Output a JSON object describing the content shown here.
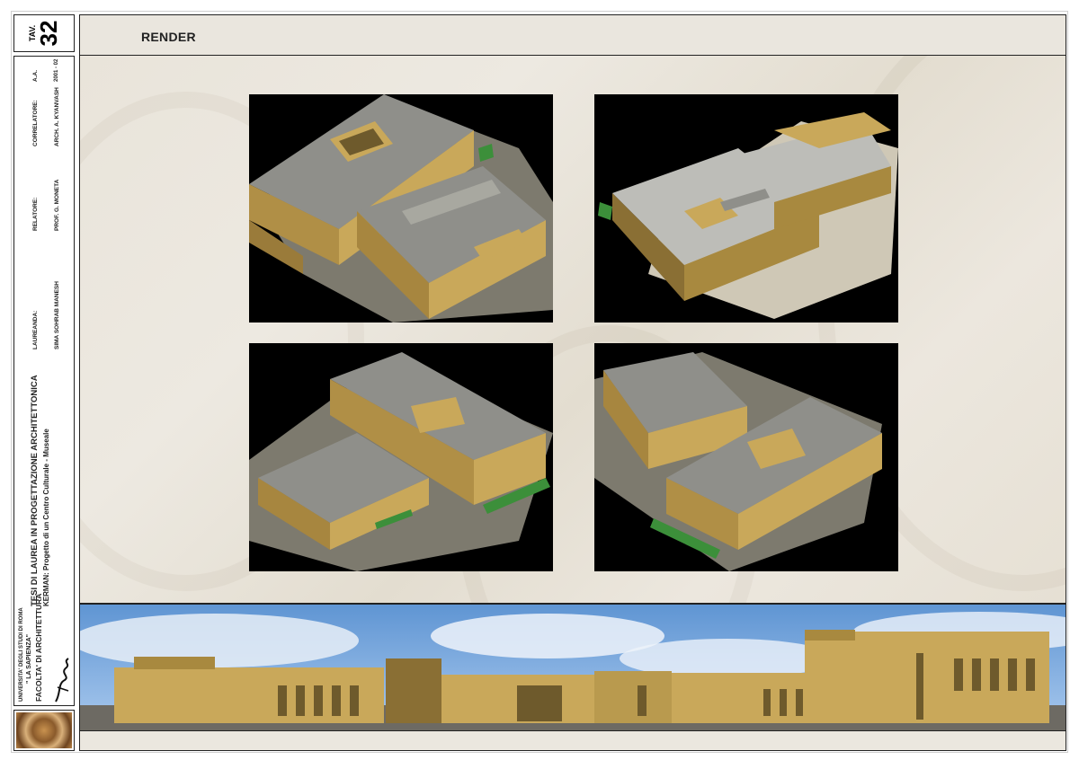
{
  "sheet": {
    "tav_label": "TAV.",
    "tav_number": "32",
    "section_title": "RENDER"
  },
  "titleblock": {
    "university": "UNIVERSITA' DEGLI STUDI DI ROMA",
    "university_name": "\" LA SAPIENZA\"",
    "faculty": "FACOLTA' DI ARCHITETTURA",
    "thesis_title": "TESI DI LAUREA IN PROGETTAZIONE ARCHITETTONICA",
    "project": "KERMAN: Progetto di un Centro Culturale - Museale",
    "laureanda_label": "LAUREANDA:",
    "laureanda": "SIMA SOHRAB MANESH",
    "relatore_label": "RELATORE:",
    "relatore": "PROF. G. MONETA",
    "correlatore_label": "CORRELATORE:",
    "correlatore": "ARCH.  A. KYANVASH",
    "aa_label": "A.A.",
    "aa": "2001 - 02"
  },
  "colors": {
    "frame": "#222222",
    "background": "#eae6de",
    "render_bg": "#000000",
    "roof": "#8f8f8a",
    "wall": "#c9a85a",
    "wall_dark": "#8a6f34",
    "grass": "#3c8f3a",
    "sky": "#6a9fd8"
  }
}
